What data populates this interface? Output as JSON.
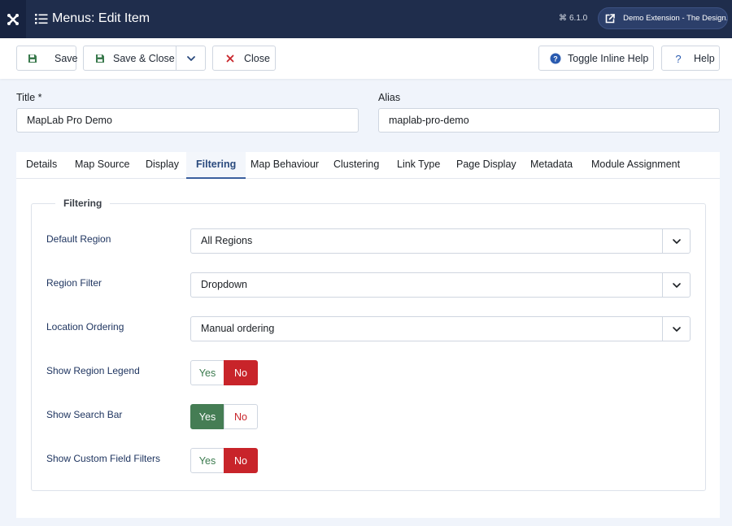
{
  "header": {
    "title": "Menus: Edit Item",
    "version": "6.1.0",
    "site_button_label": "Demo Extension - The Design...",
    "icons": [
      "joomla-logo-icon",
      "list-menu-icon",
      "command-icon",
      "external-link-icon"
    ]
  },
  "toolbar": {
    "save_label": "Save",
    "save_close_label": "Save & Close",
    "close_label": "Close",
    "toggle_help_label": "Toggle Inline Help",
    "help_label": "Help"
  },
  "form": {
    "title_label": "Title *",
    "title_value": "MapLab Pro Demo",
    "alias_label": "Alias",
    "alias_value": "maplab-pro-demo"
  },
  "tabs": [
    {
      "label": "Details",
      "active": false
    },
    {
      "label": "Map Source",
      "active": false
    },
    {
      "label": "Display",
      "active": false
    },
    {
      "label": "Filtering",
      "active": true
    },
    {
      "label": "Map Behaviour",
      "active": false
    },
    {
      "label": "Clustering",
      "active": false
    },
    {
      "label": "Link Type",
      "active": false
    },
    {
      "label": "Page Display",
      "active": false
    },
    {
      "label": "Metadata",
      "active": false
    },
    {
      "label": "Module Assignment",
      "active": false
    }
  ],
  "filtering": {
    "legend": "Filtering",
    "default_region": {
      "label": "Default Region",
      "value": "All Regions"
    },
    "region_filter": {
      "label": "Region Filter",
      "value": "Dropdown"
    },
    "location_ordering": {
      "label": "Location Ordering",
      "value": "Manual ordering"
    },
    "show_region_legend": {
      "label": "Show Region Legend",
      "value": "No"
    },
    "show_search_bar": {
      "label": "Show Search Bar",
      "value": "Yes"
    },
    "show_custom_field_filters": {
      "label": "Show Custom Field Filters",
      "value": "No"
    },
    "yes_label": "Yes",
    "no_label": "No"
  },
  "colors": {
    "header_bg": "#1f2d4c",
    "yes_active": "#457d54",
    "no_active": "#c8242a",
    "active_tab": "#3b5f9e"
  }
}
